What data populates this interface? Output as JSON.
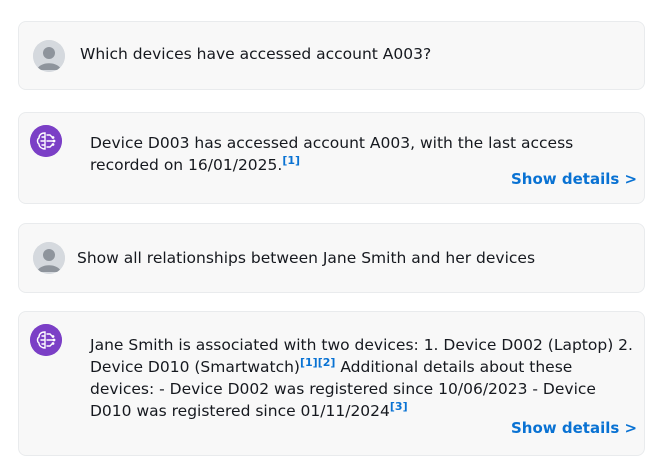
{
  "conversation": [
    {
      "role": "user",
      "text": "Which devices have accessed account A003?"
    },
    {
      "role": "assistant",
      "text_part1": "Device D003 has accessed account A003, with the last access recorded on 16/01/2025.",
      "citation1": "[1]",
      "show_details_label": "Show details >"
    },
    {
      "role": "user",
      "text": "Show all relationships between Jane Smith and her devices"
    },
    {
      "role": "assistant",
      "text_part1": "Jane Smith is associated with two devices: 1. Device D002 (Laptop) 2. Device D010 (Smartwatch)",
      "citation1": "[1]",
      "citation2": "[2]",
      "text_part2": " Additional details about these devices: - Device D002 was registered since 10/06/2023 - Device D010 was registered since 01/11/2024",
      "citation3": "[3]",
      "show_details_label": "Show details >"
    }
  ],
  "colors": {
    "card_background": "#f8f8f8",
    "link": "#0972d3",
    "ai_avatar": "#7b3fc6",
    "user_avatar": "#d1d5db"
  },
  "icons": {
    "user_avatar": "user-silhouette-icon",
    "assistant_avatar": "brain-circuit-icon"
  }
}
